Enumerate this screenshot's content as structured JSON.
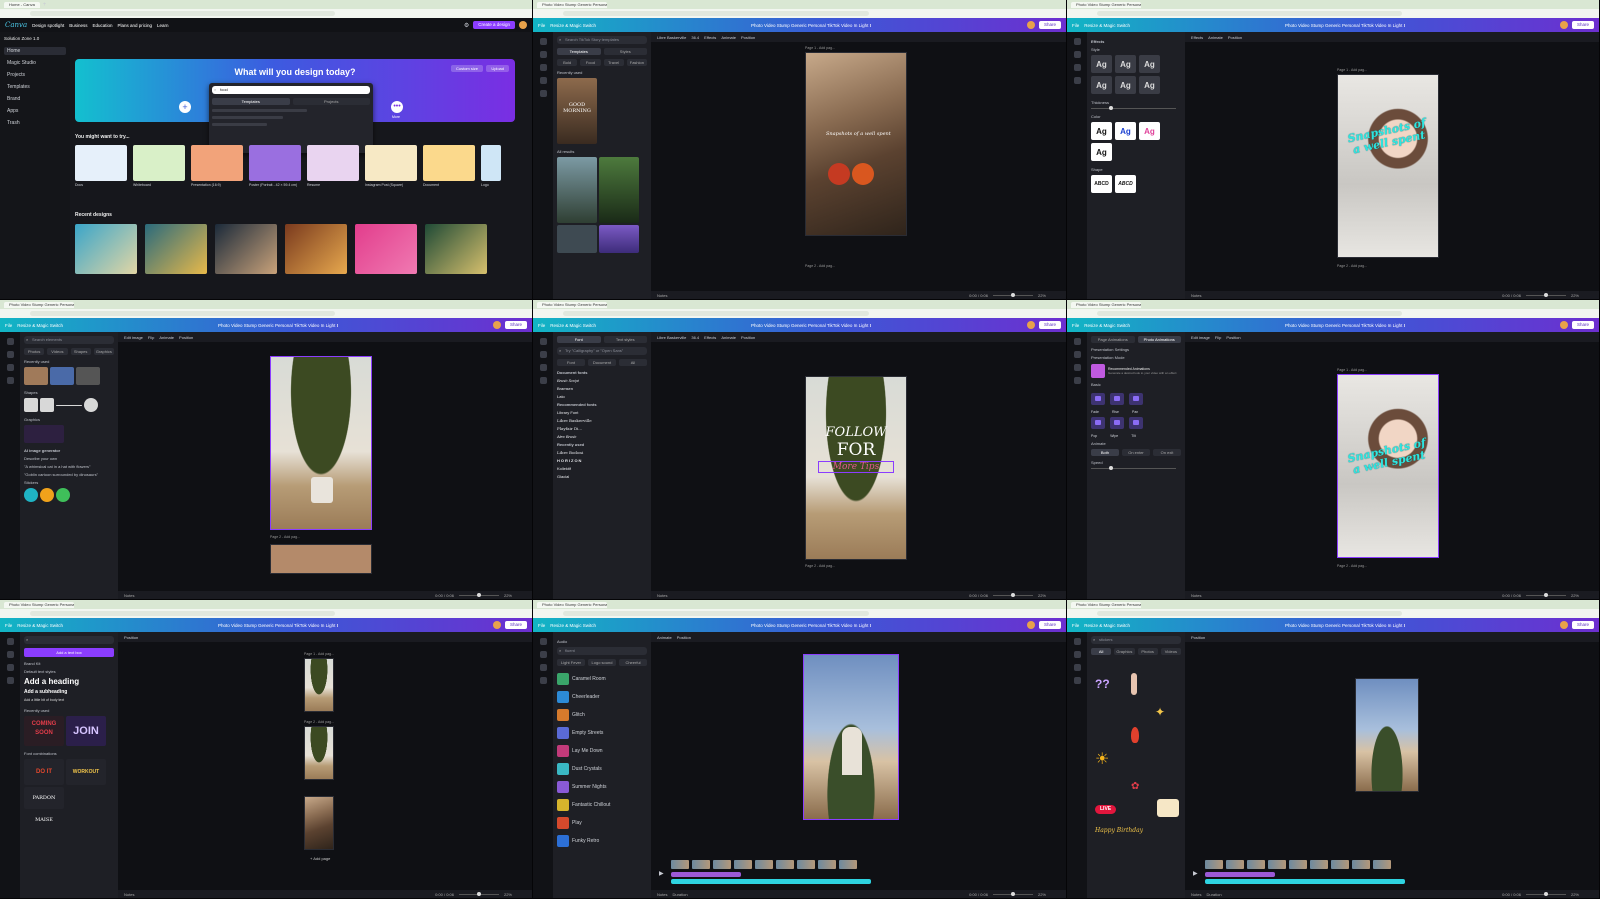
{
  "colors": {
    "canva_gradient_start": "#12b5c4",
    "canva_gradient_mid": "#3b59d6",
    "canva_gradient_end": "#6d2fd0",
    "aqua_text": "#2ee6e0",
    "panel_bg": "#1e1f25",
    "canvas_bg": "#0f1014",
    "share_text": "#5a2fc2"
  },
  "icons": {
    "search": "search-icon",
    "play": "play-icon",
    "add": "plus-icon",
    "gear": "gear-icon"
  },
  "browser": {
    "tab_label": "Photo Video Stump Generic Personal TikTok Video In Light B",
    "home_tab": "Home - Canva"
  },
  "editor": {
    "file_label": "File",
    "resize_label": "Resize & Magic Switch",
    "doc_title": "Photo Video Stump Generic Personal TikTok Video In Light B",
    "share_label": "Share",
    "notes_label": "Notes",
    "duration_label": "Duration",
    "zoom": "22%",
    "time": "0:00 / 0:06",
    "page_label": "Page 1 - Add pag...",
    "page2_label": "Page 2 - Add pag...",
    "add_page": "+ Add page",
    "effects": "Effects",
    "animate": "Animate",
    "position": "Position",
    "edit_image": "Edit image",
    "flip": "Flip"
  },
  "home": {
    "logo": "Canva",
    "nav": [
      "Design spotlight",
      "Business",
      "Education",
      "Plans and pricing",
      "Learn"
    ],
    "create_btn": "Create a design",
    "hero_title": "What will you design today?",
    "custom_size": "Custom size",
    "upload": "Upload",
    "search_value": "food",
    "search_tabs": [
      "Templates",
      "Projects"
    ],
    "suggest": "You might want to try...",
    "recent": "Recent designs",
    "more": "More",
    "sidebar": [
      "Home",
      "Magic Studio",
      "Projects",
      "Templates",
      "Brand",
      "Apps",
      "Trash"
    ],
    "team": "Solution Zone 1.0",
    "suggest_items": [
      "Docs",
      "Whiteboard",
      "Presentation (16:9)",
      "Poster (Portrait - 42 × 59.4 cm)",
      "Resume",
      "Instagram Post (Square)",
      "Document",
      "Logo"
    ]
  },
  "templates_panel": {
    "search": "Search TikTok Story templates",
    "tabs": [
      "Templates",
      "Styles"
    ],
    "chips": [
      "Bold",
      "Food",
      "Travel",
      "Fashion"
    ],
    "recent": "Recently used",
    "all": "All results",
    "tile_text": "GOOD MORNING"
  },
  "photo_caption": "Snapshots of a well spent",
  "effects_panel": {
    "title": "Effects",
    "style": "Style",
    "thickness": "Thickness",
    "color": "Color",
    "shape": "Shape",
    "sample": "Ag",
    "shape_samples": [
      "ABCD",
      "ABCD"
    ]
  },
  "elements_panel": {
    "search": "Search elements",
    "tabs": [
      "Photos",
      "Videos",
      "Shapes",
      "Graphics",
      "Magic"
    ],
    "recent": "Recently used",
    "shapes": "Shapes",
    "graphics": "Graphics",
    "ai_title": "AI image generator",
    "ai_prompt": "Describe your own",
    "prompts": [
      "\"A whimsical cat in a hat with flowers\"",
      "\"Goblin cartoon surrounded by dinosaurs\""
    ],
    "stickers": "Stickers",
    "see_all": "See all"
  },
  "font_panel": {
    "tabs": [
      "Font",
      "Text styles"
    ],
    "search": "Try \"Calligraphy\" or \"Open Sans\"",
    "filters": [
      "Font",
      "Document",
      "All"
    ],
    "doc_fonts": "Document fonts",
    "recommended": "Recommended fonts",
    "recent": "Recently used",
    "fonts": [
      "Brush Script",
      "Bramsen",
      "Lato",
      "Library Font",
      "Libre Baskerville",
      "Playfair Di...",
      "Alex Brush",
      "Libre Bodoni",
      "HORIZON",
      "Kollektif",
      "Glacial"
    ],
    "canvas_text": [
      "FOLLOW",
      "FOR",
      "More Tips"
    ],
    "font_name": "Libre Baskerville",
    "size": "36.4"
  },
  "animate_panel": {
    "tabs": [
      "Page Animations",
      "Photo Animations"
    ],
    "presets": "Presentation Settings",
    "pres_label": "Presentation Mode",
    "rec_title": "Recommended Animations",
    "rec_desc": "Generate a desired look to your video with an effect",
    "basic": "Basic",
    "animate_label": "Animate",
    "speed_label": "Speed",
    "rows": [
      [
        "Fade",
        "Rise",
        "Pan"
      ],
      [
        "Pop",
        "Wipe",
        "Tilt"
      ]
    ],
    "dirs": [
      "Both",
      "On enter",
      "On exit"
    ]
  },
  "text_panel": {
    "add_text": "Add a text box",
    "brand": "Brand Kit",
    "default_styles": "Default text styles",
    "heading": "Add a heading",
    "subheading": "Add a subheading",
    "body": "Add a little bit of body text",
    "recently": "Recently used",
    "font_combos": "Font combinations",
    "samples": [
      "COMING SOON",
      "JOIN",
      "DO IT",
      "WORKOUT",
      "PARDON MAISE"
    ]
  },
  "audio_panel": {
    "search": "fluent",
    "tabs": [
      "Audio",
      "Soundtrack",
      "Effects"
    ],
    "chips": [
      "Light Fever",
      "Logo sound",
      "Cheerful"
    ],
    "tracks": [
      "Caramel Room",
      "Cheerleader",
      "Glitch",
      "Empty Streets",
      "Lay Me Down",
      "Dust Crystals",
      "Summer Nights",
      "Fantastic Chillout",
      "Play",
      "Funky Retro"
    ]
  },
  "graphics_panel": {
    "search": "stickers",
    "tabs": [
      "All",
      "Graphics",
      "Photos",
      "Videos",
      "Audio"
    ],
    "live": "LIVE",
    "birthday": "Happy Birthday",
    "marks": "??"
  }
}
